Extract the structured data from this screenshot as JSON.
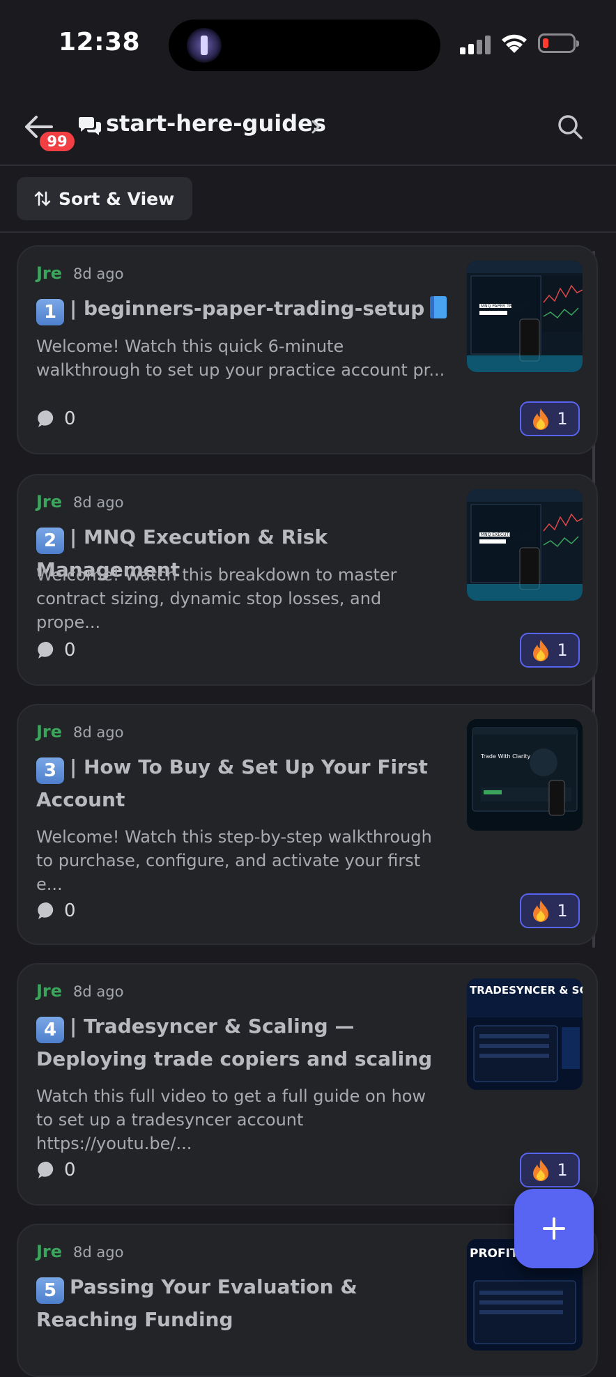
{
  "status_bar": {
    "time": "12:38"
  },
  "header": {
    "back_badge": "99",
    "channel_name": "start-here-guides"
  },
  "toolbar": {
    "sort_label": "Sort & View"
  },
  "posts": [
    {
      "author": "Jre",
      "time": "8d ago",
      "number": "1",
      "title": "| beginners-paper-trading-setup",
      "excerpt": "Welcome! Watch this quick 6-minute walkthrough to set up your practice account pr...",
      "comments": "0",
      "reaction_emoji": "fire-icon",
      "reaction_count": "1",
      "thumbnail": {
        "caption": "MNQ PAPER TRADING"
      }
    },
    {
      "author": "Jre",
      "time": "8d ago",
      "number": "2",
      "title": "| MNQ Execution & Risk Management",
      "excerpt": "Welcome! Watch this breakdown to master contract sizing, dynamic stop losses, and prope...",
      "comments": "0",
      "reaction_emoji": "fire-icon",
      "reaction_count": "1",
      "thumbnail": {
        "caption": "MNQ EXECUTION & RISK"
      }
    },
    {
      "author": "Jre",
      "time": "8d ago",
      "number": "3",
      "title": "| How To Buy & Set Up Your First Account",
      "excerpt": "Welcome! Watch this step-by-step walkthrough to purchase, configure, and activate your first e...",
      "comments": "0",
      "reaction_emoji": "fire-icon",
      "reaction_count": "1",
      "thumbnail": {
        "caption": "Trade With Clarity"
      }
    },
    {
      "author": "Jre",
      "time": "8d ago",
      "number": "4",
      "title": "| Tradesyncer & Scaling — Deploying trade copiers and scaling your accounts...",
      "excerpt": "Watch this full video to get a full guide on how to set up a tradesyncer account https://youtu.be/...",
      "comments": "0",
      "reaction_emoji": "fire-icon",
      "reaction_count": "1",
      "thumbnail": {
        "caption": "TRADESYNCER & SCALING"
      }
    },
    {
      "author": "Jre",
      "time": "8d ago",
      "number": "5",
      "title": "Passing Your Evaluation & Reaching Funding",
      "thumbnail": {
        "caption": "PROFIT ACHIEVED"
      }
    }
  ],
  "colors": {
    "accent": "#5865f2",
    "author": "#3ba55c",
    "badge": "#f23f43"
  }
}
